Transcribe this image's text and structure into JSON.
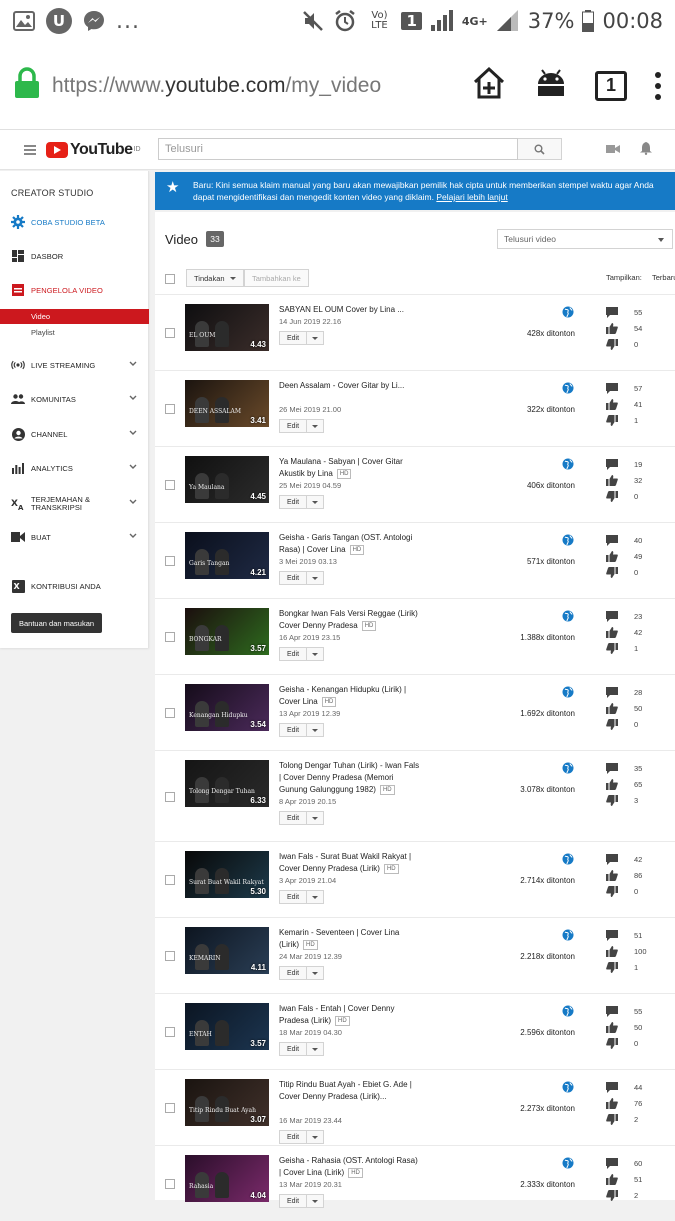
{
  "status_bar": {
    "battery": "37%",
    "time": "00:08",
    "volte": "Vo) LTE",
    "sim": "1",
    "network": "4G+"
  },
  "browser": {
    "url_prefix": "https://www.",
    "url_domain": "youtube.com",
    "url_path": "/my_video",
    "tab_count": "1"
  },
  "header": {
    "logo_text": "YouTube",
    "logo_region": "ID",
    "search_placeholder": "Telusuri"
  },
  "sidebar": {
    "title": "CREATOR STUDIO",
    "items": [
      {
        "label": "COBA STUDIO BETA"
      },
      {
        "label": "DASBOR"
      },
      {
        "label": "PENGELOLA VIDEO"
      },
      {
        "label": "LIVE STREAMING"
      },
      {
        "label": "KOMUNITAS"
      },
      {
        "label": "CHANNEL"
      },
      {
        "label": "ANALYTICS"
      },
      {
        "label": "TERJEMAHAN &\nTRANSKRIPSI"
      },
      {
        "label": "BUAT"
      },
      {
        "label": "KONTRIBUSI ANDA"
      }
    ],
    "sub_items": [
      {
        "label": "Video"
      },
      {
        "label": "Playlist"
      }
    ],
    "feedback_button": "Bantuan dan masukan"
  },
  "banner": {
    "text": "Baru: Kini semua klaim manual yang baru akan mewajibkan pemilik hak cipta untuk memberikan stempel waktu agar Anda dapat mengidentifikasi dan mengedit konten video yang diklaim.",
    "link": "Pelajari lebih lanjut"
  },
  "main": {
    "title": "Video",
    "count": "33",
    "search_placeholder": "Telusuri video",
    "actions_button": "Tindakan",
    "add_to_button": "Tambahkan ke",
    "show_label": "Tampilkan:",
    "sort_label": "Terbaru",
    "edit_label": "Edit",
    "videos": [
      {
        "title": "SABYAN EL OUM Cover by Lina ...",
        "hd": "",
        "date": "14 Jun 2019 22.16",
        "duration": "4.43",
        "views": "428x ditonton",
        "comments": "55",
        "likes": "54",
        "dislikes": "0",
        "caption": "EL OUM"
      },
      {
        "title": "Deen Assalam - Cover Gitar by Li...",
        "hd": "",
        "date": "26 Mei 2019 21.00",
        "duration": "3.41",
        "views": "322x ditonton",
        "comments": "57",
        "likes": "41",
        "dislikes": "1",
        "caption": "DEEN ASSALAM"
      },
      {
        "title": "Ya Maulana - Sabyan | Cover Gitar Akustik by Lina",
        "hd": "HD",
        "date": "25 Mei 2019 04.59",
        "duration": "4.45",
        "views": "406x ditonton",
        "comments": "19",
        "likes": "32",
        "dislikes": "0",
        "caption": "Ya Maulana"
      },
      {
        "title": "Geisha - Garis Tangan (OST. Antologi Rasa) | Cover Lina",
        "hd": "HD",
        "date": "3 Mei 2019 03.13",
        "duration": "4.21",
        "views": "571x ditonton",
        "comments": "40",
        "likes": "49",
        "dislikes": "0",
        "caption": "Garis Tangan"
      },
      {
        "title": "Bongkar Iwan Fals Versi Reggae (Lirik) Cover Denny Pradesa",
        "hd": "HD",
        "date": "16 Apr 2019 23.15",
        "duration": "3.57",
        "views": "1.388x ditonton",
        "comments": "23",
        "likes": "42",
        "dislikes": "1",
        "caption": "BONGKAR"
      },
      {
        "title": "Geisha - Kenangan Hidupku (Lirik) | Cover Lina",
        "hd": "HD",
        "date": "13 Apr 2019 12.39",
        "duration": "3.54",
        "views": "1.692x ditonton",
        "comments": "28",
        "likes": "50",
        "dislikes": "0",
        "caption": "Kenangan Hidupku"
      },
      {
        "title": "Tolong Dengar Tuhan (Lirik) - Iwan Fals | Cover Denny Pradesa (Memori Gunung Galunggung 1982)",
        "hd": "HD",
        "date": "8 Apr 2019 20.15",
        "duration": "6.33",
        "views": "3.078x ditonton",
        "comments": "35",
        "likes": "65",
        "dislikes": "3",
        "caption": "Tolong Dengar Tuhan"
      },
      {
        "title": "Iwan Fals - Surat Buat Wakil Rakyat | Cover Denny Pradesa (Lirik)",
        "hd": "HD",
        "date": "3 Apr 2019 21.04",
        "duration": "5.30",
        "views": "2.714x ditonton",
        "comments": "42",
        "likes": "86",
        "dislikes": "0",
        "caption": "Surat Buat Wakil Rakyat"
      },
      {
        "title": "Kemarin - Seventeen | Cover Lina (Lirik)",
        "hd": "HD",
        "date": "24 Mar 2019 12.39",
        "duration": "4.11",
        "views": "2.218x ditonton",
        "comments": "51",
        "likes": "100",
        "dislikes": "1",
        "caption": "KEMARIN"
      },
      {
        "title": "Iwan Fals - Entah | Cover Denny Pradesa (Lirik)",
        "hd": "HD",
        "date": "18 Mar 2019 04.30",
        "duration": "3.57",
        "views": "2.596x ditonton",
        "comments": "55",
        "likes": "50",
        "dislikes": "0",
        "caption": "ENTAH"
      },
      {
        "title": "Titip Rindu Buat Ayah - Ebiet G. Ade | Cover Denny Pradesa (Lirik)...",
        "hd": "",
        "date": "16 Mar 2019 23.44",
        "duration": "3.07",
        "views": "2.273x ditonton",
        "comments": "44",
        "likes": "76",
        "dislikes": "2",
        "caption": "Titip Rindu Buat Ayah"
      },
      {
        "title": "Geisha - Rahasia (OST. Antologi Rasa) | Cover Lina (Lirik)",
        "hd": "HD",
        "date": "13 Mar 2019 20.31",
        "duration": "4.04",
        "views": "2.333x ditonton",
        "comments": "60",
        "likes": "51",
        "dislikes": "2",
        "caption": "Rahasia"
      }
    ]
  },
  "colors": {
    "brand_red": "#e62117",
    "active_red": "#cc181e",
    "banner_blue": "#167ac6"
  }
}
